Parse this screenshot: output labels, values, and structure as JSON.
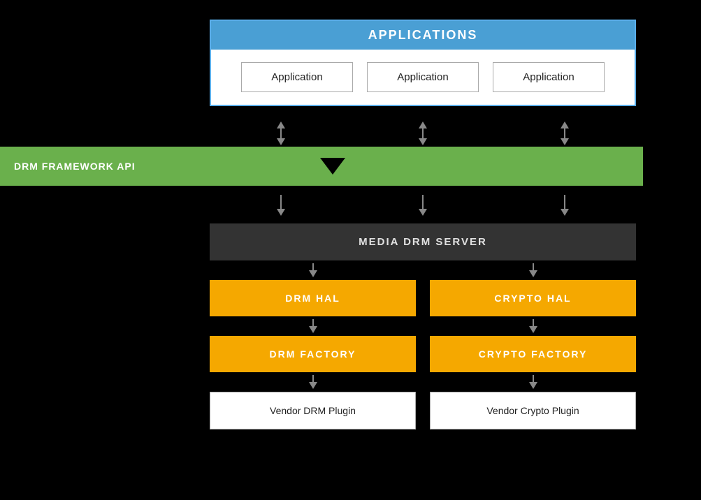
{
  "background": "#000000",
  "applications": {
    "header": "APPLICATIONS",
    "header_color": "#4a9fd4",
    "apps": [
      "Application",
      "Application",
      "Application"
    ]
  },
  "drm_framework": {
    "label": "DRM FRAMEWORK API",
    "color": "#6ab04c"
  },
  "media_drm_server": {
    "label": "MEDIA DRM SERVER",
    "bg": "#333333",
    "text_color": "#e0e0e0"
  },
  "hal_row": {
    "items": [
      "DRM HAL",
      "CRYPTO HAL"
    ],
    "bg": "#f5a800",
    "text_color": "#ffffff"
  },
  "factory_row": {
    "items": [
      "DRM FACTORY",
      "CRYPTO FACTORY"
    ],
    "bg": "#f5a800",
    "text_color": "#ffffff"
  },
  "plugin_row": {
    "items": [
      "Vendor DRM Plugin",
      "Vendor Crypto Plugin"
    ],
    "bg": "#ffffff",
    "text_color": "#222222"
  }
}
